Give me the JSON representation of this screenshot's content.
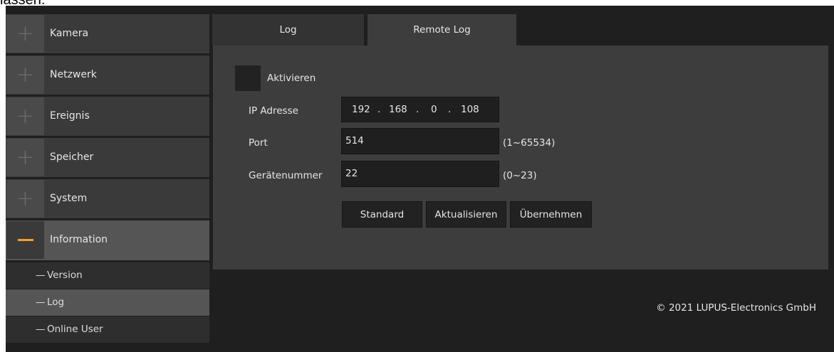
{
  "page_top_text": "lassen.",
  "sidebar": {
    "items": [
      {
        "label": "Kamera",
        "icon": "plus-icon"
      },
      {
        "label": "Netzwerk",
        "icon": "plus-icon"
      },
      {
        "label": "Ereignis",
        "icon": "plus-icon"
      },
      {
        "label": "Speicher",
        "icon": "plus-icon"
      },
      {
        "label": "System",
        "icon": "plus-icon"
      },
      {
        "label": "Information",
        "icon": "minus-icon",
        "active": true
      }
    ],
    "sub_items": [
      {
        "label": "Version"
      },
      {
        "label": "Log",
        "active": true
      },
      {
        "label": "Online User"
      }
    ],
    "dash": "—"
  },
  "tabs": [
    {
      "label": "Log"
    },
    {
      "label": "Remote Log",
      "active": true
    }
  ],
  "form": {
    "activate_label": "Aktivieren",
    "ip_label": "IP Adresse",
    "ip_octets": [
      "192",
      "168",
      "0",
      "108"
    ],
    "ip_sep": ".",
    "port_label": "Port",
    "port_value": "514",
    "port_range": "(1~65534)",
    "device_label": "Gerätenummer",
    "device_value": "22",
    "device_range": "(0~23)"
  },
  "buttons": {
    "standard": "Standard",
    "refresh": "Aktualisieren",
    "apply": "Übernehmen"
  },
  "footer": "© 2021 LUPUS-Electronics GmbH",
  "colors": {
    "accent": "#f0a030",
    "background": "#1f1f1f",
    "panel": "#3d3d3d"
  }
}
